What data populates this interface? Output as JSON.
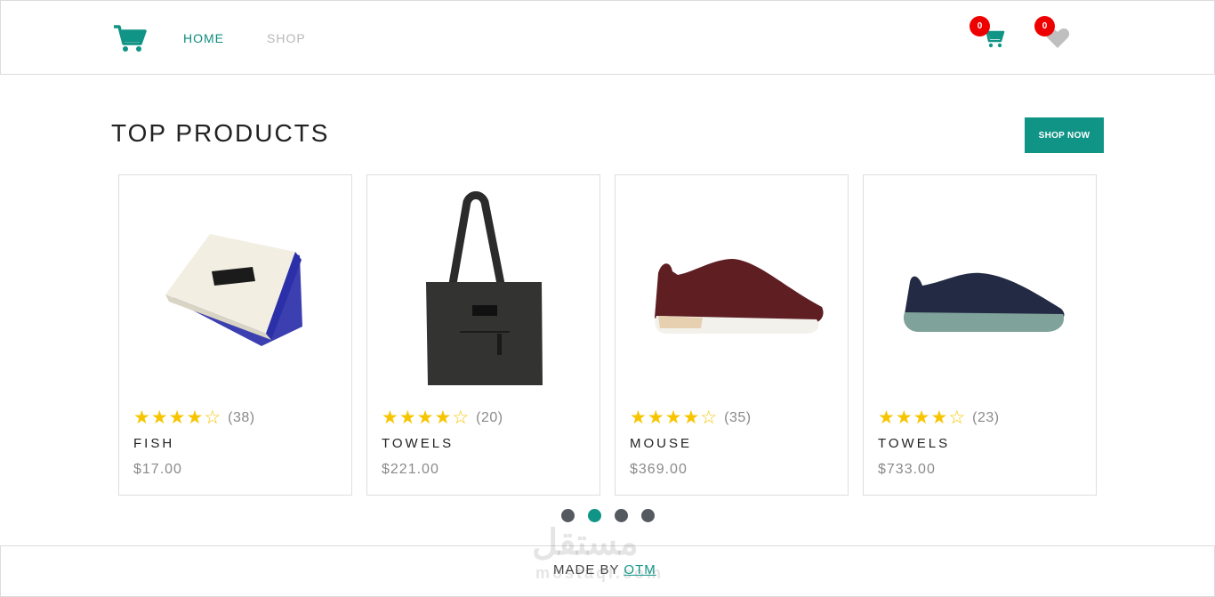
{
  "header": {
    "logo_icon": "shopping-cart-icon",
    "nav": [
      {
        "label": "HOME",
        "active": true
      },
      {
        "label": "SHOP",
        "active": false
      }
    ],
    "cart_count": "0",
    "wishlist_count": "0",
    "accent_color": "#109486",
    "badge_color": "#ee0000"
  },
  "section": {
    "title": "TOP PRODUCTS",
    "cta_label": "SHOP NOW"
  },
  "products": [
    {
      "name": "FISH",
      "price": "$17.00",
      "rating": 4,
      "reviews": "(38)",
      "image": "wallet-product-image"
    },
    {
      "name": "TOWELS",
      "price": "$221.00",
      "rating": 4,
      "reviews": "(20)",
      "image": "tote-bag-product-image"
    },
    {
      "name": "MOUSE",
      "price": "$369.00",
      "rating": 4,
      "reviews": "(35)",
      "image": "burgundy-sneaker-product-image"
    },
    {
      "name": "TOWELS",
      "price": "$733.00",
      "rating": 4,
      "reviews": "(23)",
      "image": "navy-sneaker-product-image"
    }
  ],
  "carousel": {
    "total": 4,
    "active": 2
  },
  "footer": {
    "prefix": "MADE BY",
    "link": "OTM"
  },
  "watermark": {
    "logo": "مستقل",
    "sub": "mostaql.com"
  }
}
